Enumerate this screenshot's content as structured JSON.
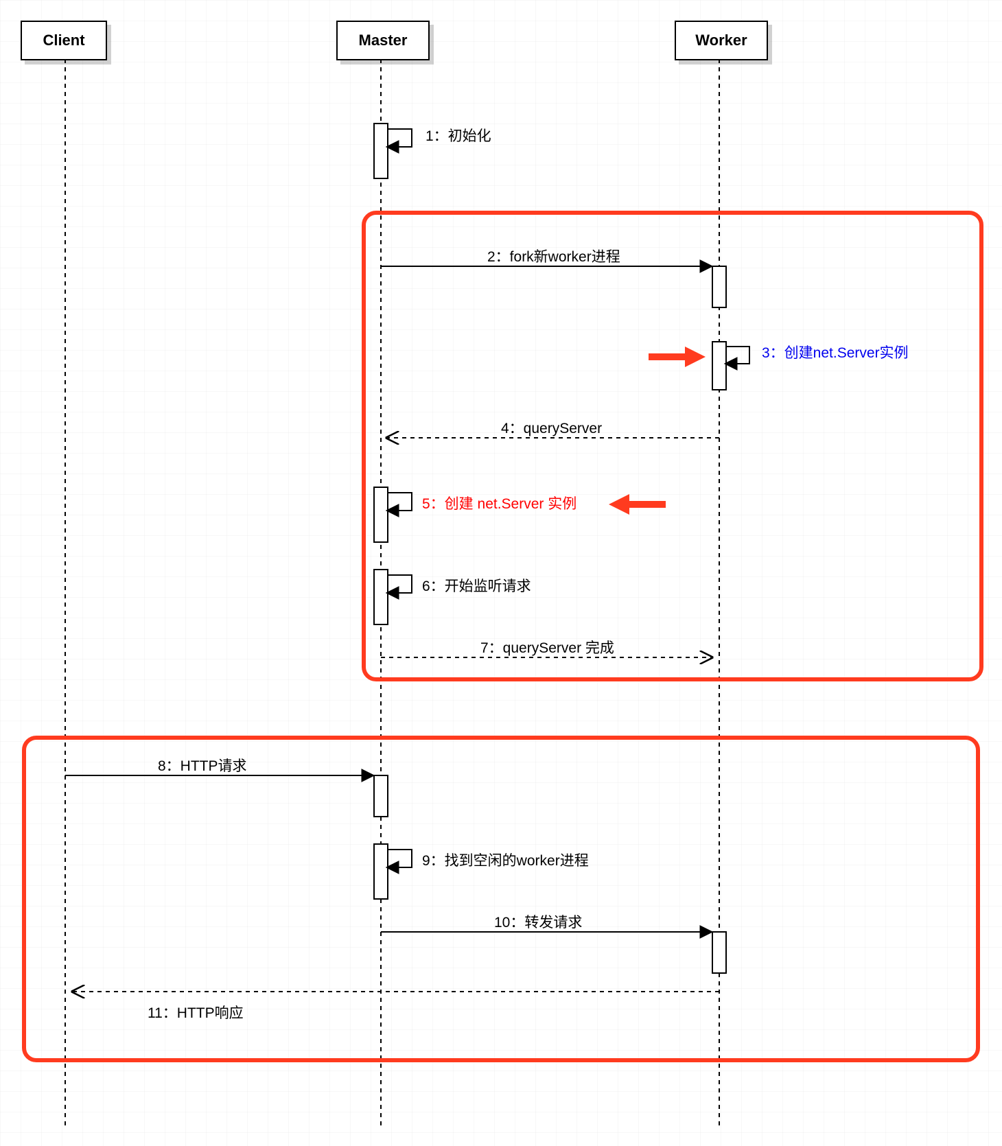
{
  "participants": {
    "client": "Client",
    "master": "Master",
    "worker": "Worker"
  },
  "messages": {
    "m1": "1：初始化",
    "m2": "2：fork新worker进程",
    "m3": "3：创建net.Server实例",
    "m4": "4：queryServer",
    "m5": "5：创建 net.Server 实例",
    "m6": "6：开始监听请求",
    "m7": "7：queryServer 完成",
    "m8": "8：HTTP请求",
    "m9": "9：找到空闲的worker进程",
    "m10": "10：转发请求",
    "m11": "11：HTTP响应"
  },
  "colors": {
    "highlight_box": "#ff3b1f",
    "pointer_arrow": "#ff3b1f",
    "msg3": "#0000ee",
    "msg5": "#ff0000"
  }
}
